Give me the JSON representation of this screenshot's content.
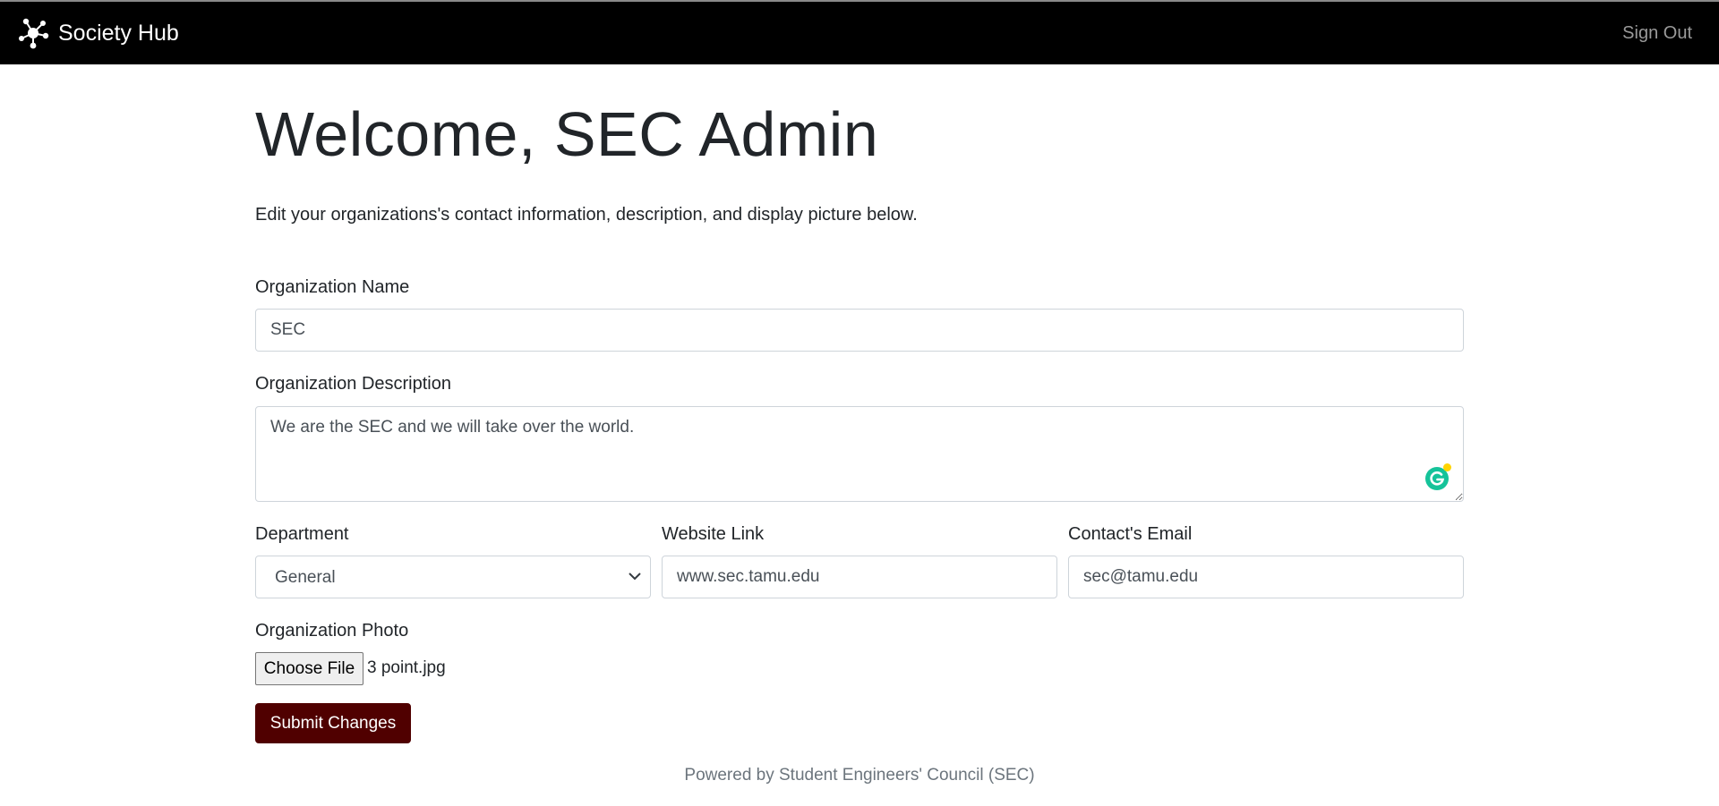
{
  "nav": {
    "brand": "Society Hub",
    "sign_out": "Sign Out"
  },
  "page": {
    "welcome": "Welcome, SEC Admin",
    "lead": "Edit your organizations's contact information, description, and display picture below."
  },
  "form": {
    "org_name_label": "Organization Name",
    "org_name_value": "SEC",
    "org_desc_label": "Organization Description",
    "org_desc_value": "We are the SEC and we will take over the world.",
    "department_label": "Department",
    "department_value": "General",
    "website_label": "Website Link",
    "website_value": "www.sec.tamu.edu",
    "email_label": "Contact's Email",
    "email_value": "sec@tamu.edu",
    "photo_label": "Organization Photo",
    "choose_file": "Choose File",
    "file_name": "3 point.jpg",
    "submit": "Submit Changes"
  },
  "footer": {
    "text": "Powered by Student Engineers' Council (SEC)"
  },
  "colors": {
    "navbar": "#000000",
    "submit": "#500000",
    "grammarly": "#15c39a"
  },
  "icons": {
    "brand": "network-nodes-icon",
    "select": "chevron-down-icon",
    "extension": "grammarly-icon"
  }
}
